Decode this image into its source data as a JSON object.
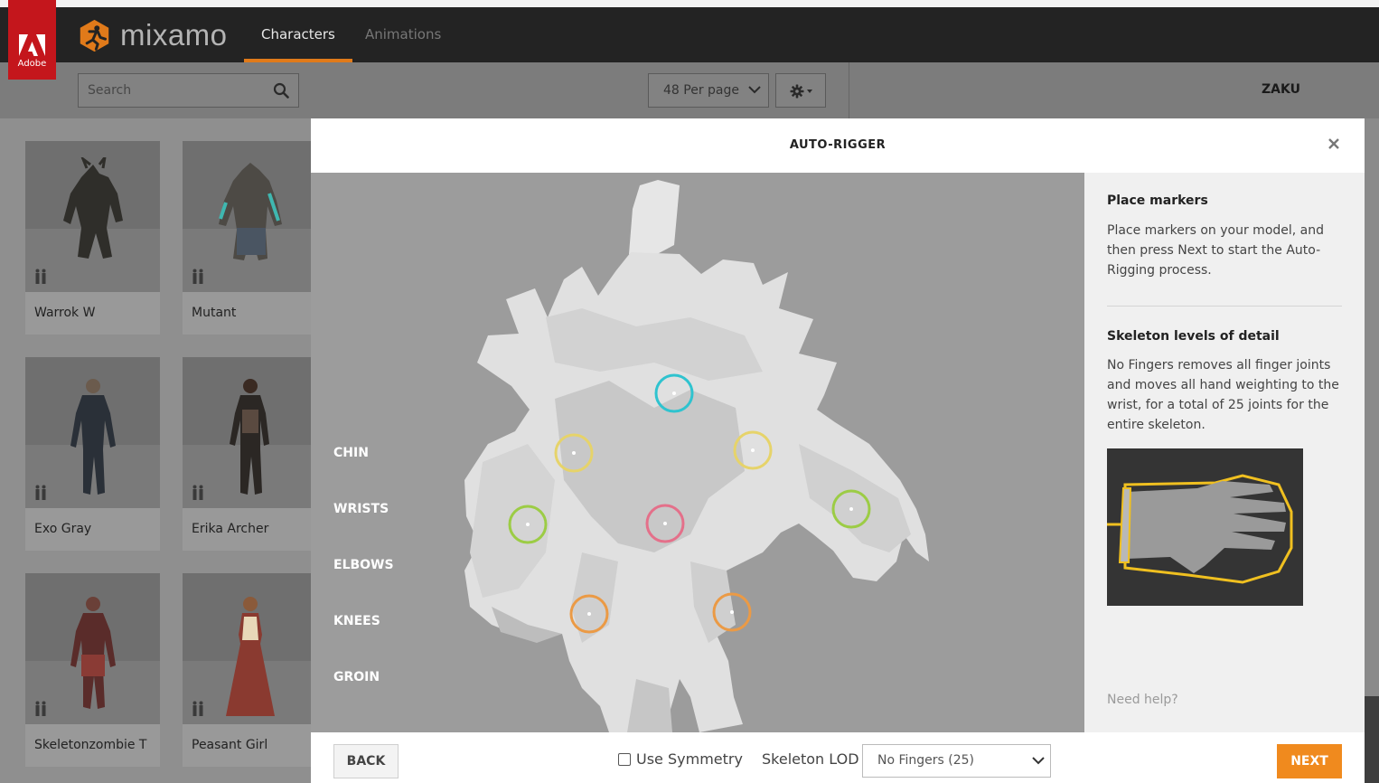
{
  "header": {
    "adobe_label": "Adobe",
    "brand": "mixamo",
    "tabs": [
      {
        "label": "Characters",
        "active": true
      },
      {
        "label": "Animations",
        "active": false
      }
    ],
    "accent_color": "#e07a1a"
  },
  "toolbar": {
    "search_placeholder": "Search",
    "per_page": "48 Per page",
    "settings_icon": "gear-icon",
    "username": "ZAKU"
  },
  "characters": [
    {
      "name": "Warrok W"
    },
    {
      "name": "Mutant"
    },
    {
      "name": "Exo Gray"
    },
    {
      "name": "Erika Archer"
    },
    {
      "name": "Skeletonzombie T"
    },
    {
      "name": "Peasant Girl"
    }
  ],
  "modal": {
    "title": "AUTO-RIGGER",
    "viewport_labels": [
      "CHIN",
      "WRISTS",
      "ELBOWS",
      "KNEES",
      "GROIN"
    ],
    "marker_colors": {
      "chin": "#2fc3cf",
      "wrists": "#e6d36a",
      "elbows": "#9ccc45",
      "knees": "#eb9a45",
      "groin": "#e4708a"
    },
    "side": {
      "heading1": "Place markers",
      "text1": "Place markers on your model, and then press Next to start the Auto-Rigging process.",
      "heading2": "Skeleton levels of detail",
      "text2": "No Fingers removes all finger joints and moves all hand weighting to the wrist, for a total of 25 joints for the entire skeleton.",
      "help": "Need help?"
    },
    "footer": {
      "back": "BACK",
      "symmetry": "Use Symmetry",
      "symmetry_checked": false,
      "lod_label": "Skeleton LOD",
      "lod_value": "No Fingers (25)",
      "next": "NEXT"
    }
  }
}
